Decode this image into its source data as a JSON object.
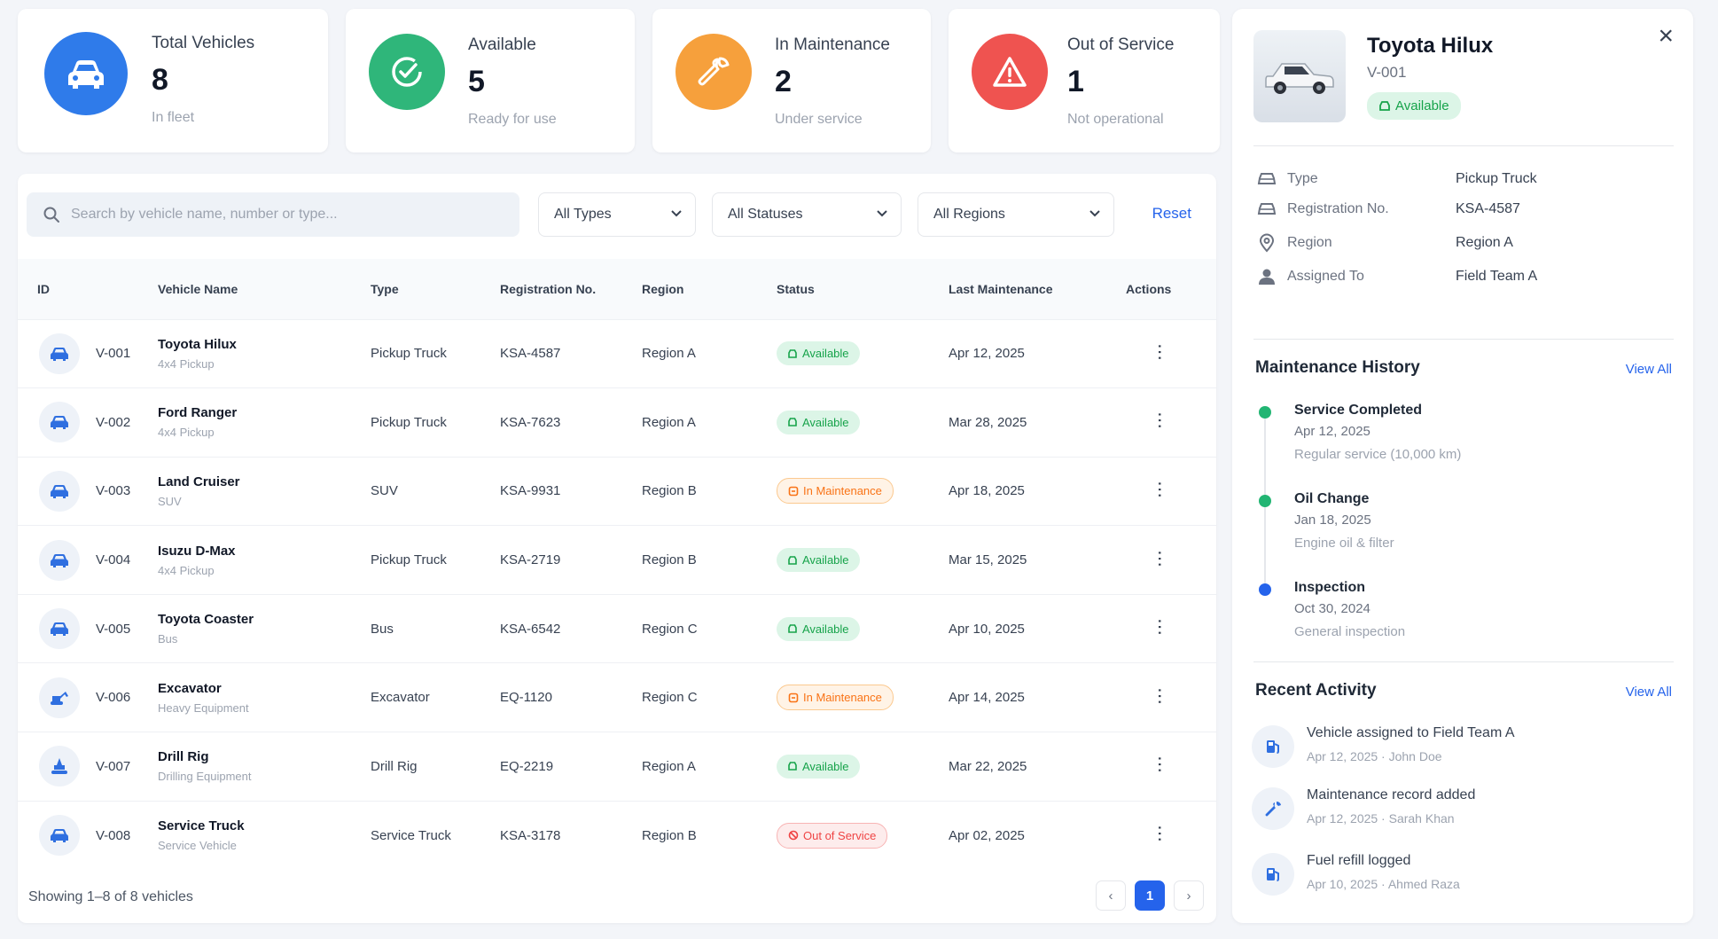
{
  "stats": [
    {
      "label": "Total Vehicles",
      "value": "8",
      "sub": "In fleet",
      "color": "#2f7bea",
      "icon": "car-icon"
    },
    {
      "label": "Available",
      "value": "5",
      "sub": "Ready for use",
      "color": "#2fb67a",
      "icon": "check-badge-icon"
    },
    {
      "label": "In Maintenance",
      "value": "2",
      "sub": "Under service",
      "color": "#f6a03c",
      "icon": "wrench-icon"
    },
    {
      "label": "Out of Service",
      "value": "1",
      "sub": "Not operational",
      "color": "#ef5350",
      "icon": "warning-icon"
    }
  ],
  "filters": {
    "search_placeholder": "Search by vehicle name, number or type...",
    "type": "All Types",
    "status": "All Statuses",
    "region": "All Regions",
    "reset": "Reset"
  },
  "table": {
    "headers": [
      "ID",
      "Vehicle Name",
      "Type",
      "Registration No.",
      "Region",
      "Status",
      "Last Maintenance",
      "Actions"
    ],
    "rows": [
      {
        "id": "V-001",
        "name": "Toyota Hilux",
        "sub": "4x4 Pickup",
        "type": "Pickup Truck",
        "reg": "KSA-4587",
        "region": "Region A",
        "status": "Available",
        "last": "Apr 12, 2025",
        "icon": "car-icon"
      },
      {
        "id": "V-002",
        "name": "Ford Ranger",
        "sub": "4x4 Pickup",
        "type": "Pickup Truck",
        "reg": "KSA-7623",
        "region": "Region A",
        "status": "Available",
        "last": "Mar 28, 2025",
        "icon": "car-icon"
      },
      {
        "id": "V-003",
        "name": "Land Cruiser",
        "sub": "SUV",
        "type": "SUV",
        "reg": "KSA-9931",
        "region": "Region B",
        "status": "In Maintenance",
        "last": "Apr 18, 2025",
        "icon": "car-icon"
      },
      {
        "id": "V-004",
        "name": "Isuzu D-Max",
        "sub": "4x4 Pickup",
        "type": "Pickup Truck",
        "reg": "KSA-2719",
        "region": "Region B",
        "status": "Available",
        "last": "Mar 15, 2025",
        "icon": "car-icon"
      },
      {
        "id": "V-005",
        "name": "Toyota Coaster",
        "sub": "Bus",
        "type": "Bus",
        "reg": "KSA-6542",
        "region": "Region C",
        "status": "Available",
        "last": "Apr 10, 2025",
        "icon": "car-icon"
      },
      {
        "id": "V-006",
        "name": "Excavator",
        "sub": "Heavy Equipment",
        "type": "Excavator",
        "reg": "EQ-1120",
        "region": "Region C",
        "status": "In Maintenance",
        "last": "Apr 14, 2025",
        "icon": "excavator-icon"
      },
      {
        "id": "V-007",
        "name": "Drill Rig",
        "sub": "Drilling Equipment",
        "type": "Drill Rig",
        "reg": "EQ-2219",
        "region": "Region A",
        "status": "Available",
        "last": "Mar 22, 2025",
        "icon": "drill-icon"
      },
      {
        "id": "V-008",
        "name": "Service Truck",
        "sub": "Service Vehicle",
        "type": "Service Truck",
        "reg": "KSA-3178",
        "region": "Region B",
        "status": "Out of Service",
        "last": "Apr 02, 2025",
        "icon": "car-icon"
      }
    ]
  },
  "footer": {
    "showing": "Showing 1–8 of 8 vehicles",
    "page": "1"
  },
  "detail": {
    "title": "Toyota Hilux",
    "id": "V-001",
    "status": "Available",
    "info": [
      {
        "label": "Type",
        "value": "Pickup Truck",
        "icon": "car-icon"
      },
      {
        "label": "Registration No.",
        "value": "KSA-4587",
        "icon": "car-icon"
      },
      {
        "label": "Region",
        "value": "Region A",
        "icon": "map-pin-icon"
      },
      {
        "label": "Assigned To",
        "value": "Field Team A",
        "icon": "user-icon"
      }
    ],
    "maintenance_title": "Maintenance History",
    "view_all": "View All",
    "history": [
      {
        "title": "Service Completed",
        "date": "Apr 12, 2025",
        "desc": "Regular service (10,000 km)",
        "color": "#22b573"
      },
      {
        "title": "Oil Change",
        "date": "Jan 18, 2025",
        "desc": "Engine oil & filter",
        "color": "#22b573"
      },
      {
        "title": "Inspection",
        "date": "Oct 30, 2024",
        "desc": "General inspection",
        "color": "#2563eb"
      }
    ],
    "activity_title": "Recent Activity",
    "activity": [
      {
        "title": "Vehicle assigned to Field Team A",
        "meta": "Apr 12, 2025 · John Doe",
        "icon": "fuel-icon"
      },
      {
        "title": "Maintenance record added",
        "meta": "Apr 12, 2025 · Sarah Khan",
        "icon": "wrench-icon"
      },
      {
        "title": "Fuel refill logged",
        "meta": "Apr 10, 2025 · Ahmed Raza",
        "icon": "fuel-icon"
      }
    ]
  }
}
